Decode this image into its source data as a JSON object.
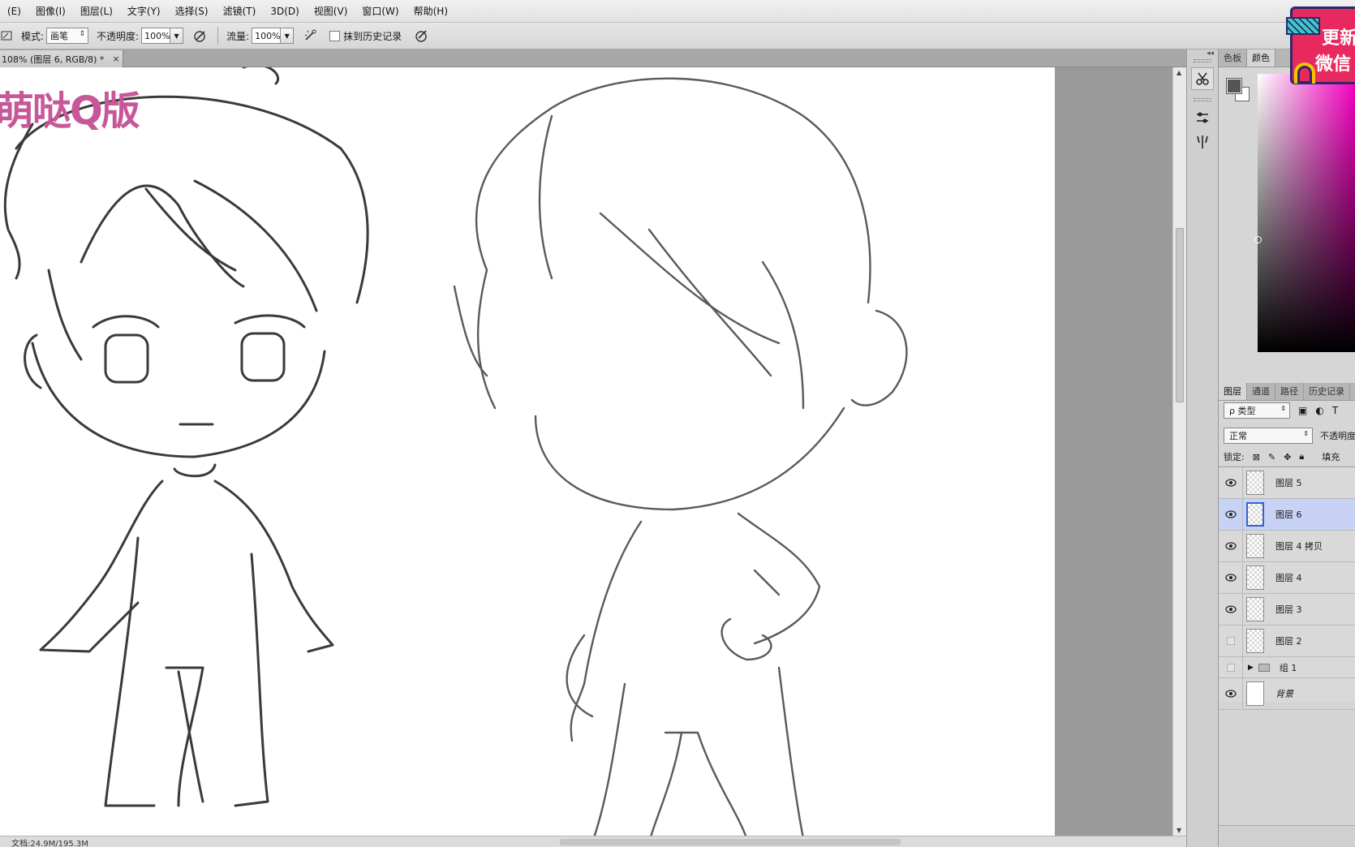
{
  "menu": [
    "(E)",
    "图像(I)",
    "图层(L)",
    "文字(Y)",
    "选择(S)",
    "滤镜(T)",
    "3D(D)",
    "视图(V)",
    "窗口(W)",
    "帮助(H)"
  ],
  "options": {
    "mode_label": "模式:",
    "mode_value": "画笔",
    "opacity_label": "不透明度:",
    "opacity_value": "100%",
    "flow_label": "流量:",
    "flow_value": "100%",
    "history_label": "抹到历史记录"
  },
  "doc_tab": {
    "title": "108% (图层 6, RGB/8) *",
    "close": "×"
  },
  "watermark": "萌哒Q版",
  "status": "文档:24.9M/195.3M",
  "color_panel": {
    "tabs": [
      "色板",
      "颜色"
    ]
  },
  "layers_panel": {
    "tabs": [
      "图层",
      "通道",
      "路径",
      "历史记录"
    ],
    "filter_value": "ρ 类型",
    "blend_mode": "正常",
    "opacity_label": "不透明度",
    "lock_label": "锁定:",
    "fill_label": "填充",
    "layers": [
      {
        "name": "图层 5",
        "visible": true,
        "selected": false
      },
      {
        "name": "图层 6",
        "visible": true,
        "selected": true
      },
      {
        "name": "图层 4 拷贝",
        "visible": true,
        "selected": false
      },
      {
        "name": "图层 4",
        "visible": true,
        "selected": false
      },
      {
        "name": "图层 3",
        "visible": true,
        "selected": false
      },
      {
        "name": "图层 2",
        "visible": false,
        "selected": false
      },
      {
        "name": "组 1",
        "visible": false,
        "selected": false,
        "group": true
      },
      {
        "name": "背景",
        "visible": true,
        "selected": false
      }
    ]
  },
  "badge": {
    "line1": "更新",
    "line2": "微信"
  },
  "colors": {
    "accent_selected": "#c8d2f4",
    "watermark": "#c8579a",
    "badge": "#e8295f"
  }
}
